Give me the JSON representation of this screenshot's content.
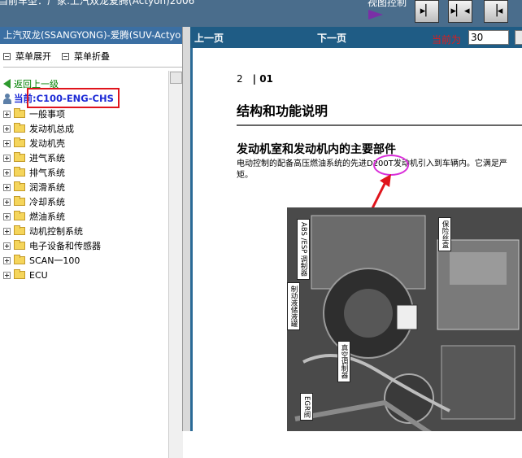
{
  "window": {
    "title": "当前车型：厂家:上汽双龙爱腾(Actyon)2006",
    "view_control": "视图控制"
  },
  "sidebar": {
    "header": "上汽双龙(SSANGYONG)-爱腾(SUV-Actyo",
    "expand_label": "菜单展开",
    "collapse_label": "菜单折叠",
    "back_label": "返回上一级",
    "current_label": "当前:C100-ENG-CHS",
    "items": [
      {
        "label": "一般事项"
      },
      {
        "label": "发动机总成"
      },
      {
        "label": "发动机壳"
      },
      {
        "label": "进气系统"
      },
      {
        "label": "排气系统"
      },
      {
        "label": "润滑系统"
      },
      {
        "label": "冷却系统"
      },
      {
        "label": "燃油系统"
      },
      {
        "label": "动机控制系统"
      },
      {
        "label": "电子设备和传感器"
      },
      {
        "label": "SCAN一100"
      },
      {
        "label": "ECU"
      }
    ]
  },
  "nav": {
    "prev_label": "上一页",
    "next_label": "下一页",
    "current_page_label": "当前为",
    "current_page_value": "30"
  },
  "document": {
    "page_number": "2",
    "section": "| 01",
    "heading": "结构和功能说明",
    "subheading": "发动机室和发动机内的主要部件",
    "paragraph_line1": "电动控制的配备高压燃油系统的先进D200T发动机引入到车辆内。它满足严",
    "paragraph_line2": "矩。",
    "figure_labels": [
      "ABS /ESP 调制器",
      "制动液储液罐",
      "真空调制器",
      "EGR阀",
      "保险丝盒"
    ]
  },
  "colors": {
    "header_blue": "#1f5c85",
    "highlight_red": "#e0141c",
    "annotation_magenta": "#d92fd9"
  }
}
